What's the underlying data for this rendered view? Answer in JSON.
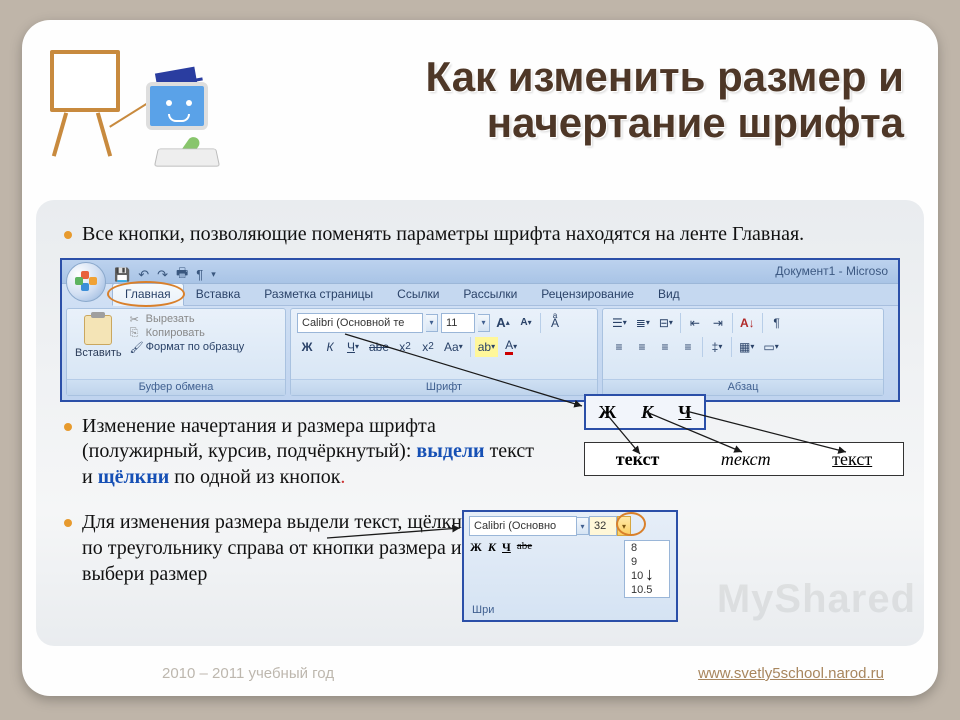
{
  "title": "Как изменить размер и начертание шрифта",
  "bullets": {
    "b1": "Все кнопки, позволяющие поменять параметры шрифта находятся на ленте Главная.",
    "b2_part1": "Изменение начертания  и размера шрифта (полужирный, курсив, подчёркнутый): ",
    "b2_hl1": "выдели",
    "b2_mid": " текст и ",
    "b2_hl2": "щёлкни",
    "b2_part2": " по одной из кнопок",
    "b2_dot": ".",
    "b3": "Для изменения размера выдели текст, щёлкни по треугольнику справа от кнопки размера  и выбери размер"
  },
  "ribbon": {
    "doc_title": "Документ1 - Microso",
    "tabs": [
      "Главная",
      "Вставка",
      "Разметка страницы",
      "Ссылки",
      "Рассылки",
      "Рецензирование",
      "Вид"
    ],
    "groups": {
      "clipboard": "Буфер обмена",
      "font": "Шрифт",
      "paragraph": "Абзац"
    },
    "paste": "Вставить",
    "cut": "Вырезать",
    "copy": "Копировать",
    "format_painter": "Формат по образцу",
    "font_name": "Calibri (Основной те",
    "font_size": "11",
    "bold": "Ж",
    "italic": "К",
    "underline": "Ч",
    "strike": "abe",
    "sub": "x₂",
    "sup": "x²",
    "case": "Aa",
    "grow": "A",
    "shrink": "A",
    "clear": "ᴬ",
    "highlight": "ab",
    "color": "A"
  },
  "biu": {
    "b": "Ж",
    "i": "К",
    "u": "Ч"
  },
  "samples": {
    "s1": "текст",
    "s2": "текст",
    "s3": "текст"
  },
  "sizecall": {
    "font": "Calibri (Основно",
    "size": "32",
    "sizes": [
      "8",
      "9",
      "10",
      "10.5"
    ],
    "label": "Шри",
    "b": "Ж",
    "i": "К",
    "u": "Ч",
    "s": "abe"
  },
  "footer": {
    "left": "2010 – 2011 учебный год",
    "right": "www.svetly5school.narod.ru"
  },
  "watermark": "MyShared"
}
